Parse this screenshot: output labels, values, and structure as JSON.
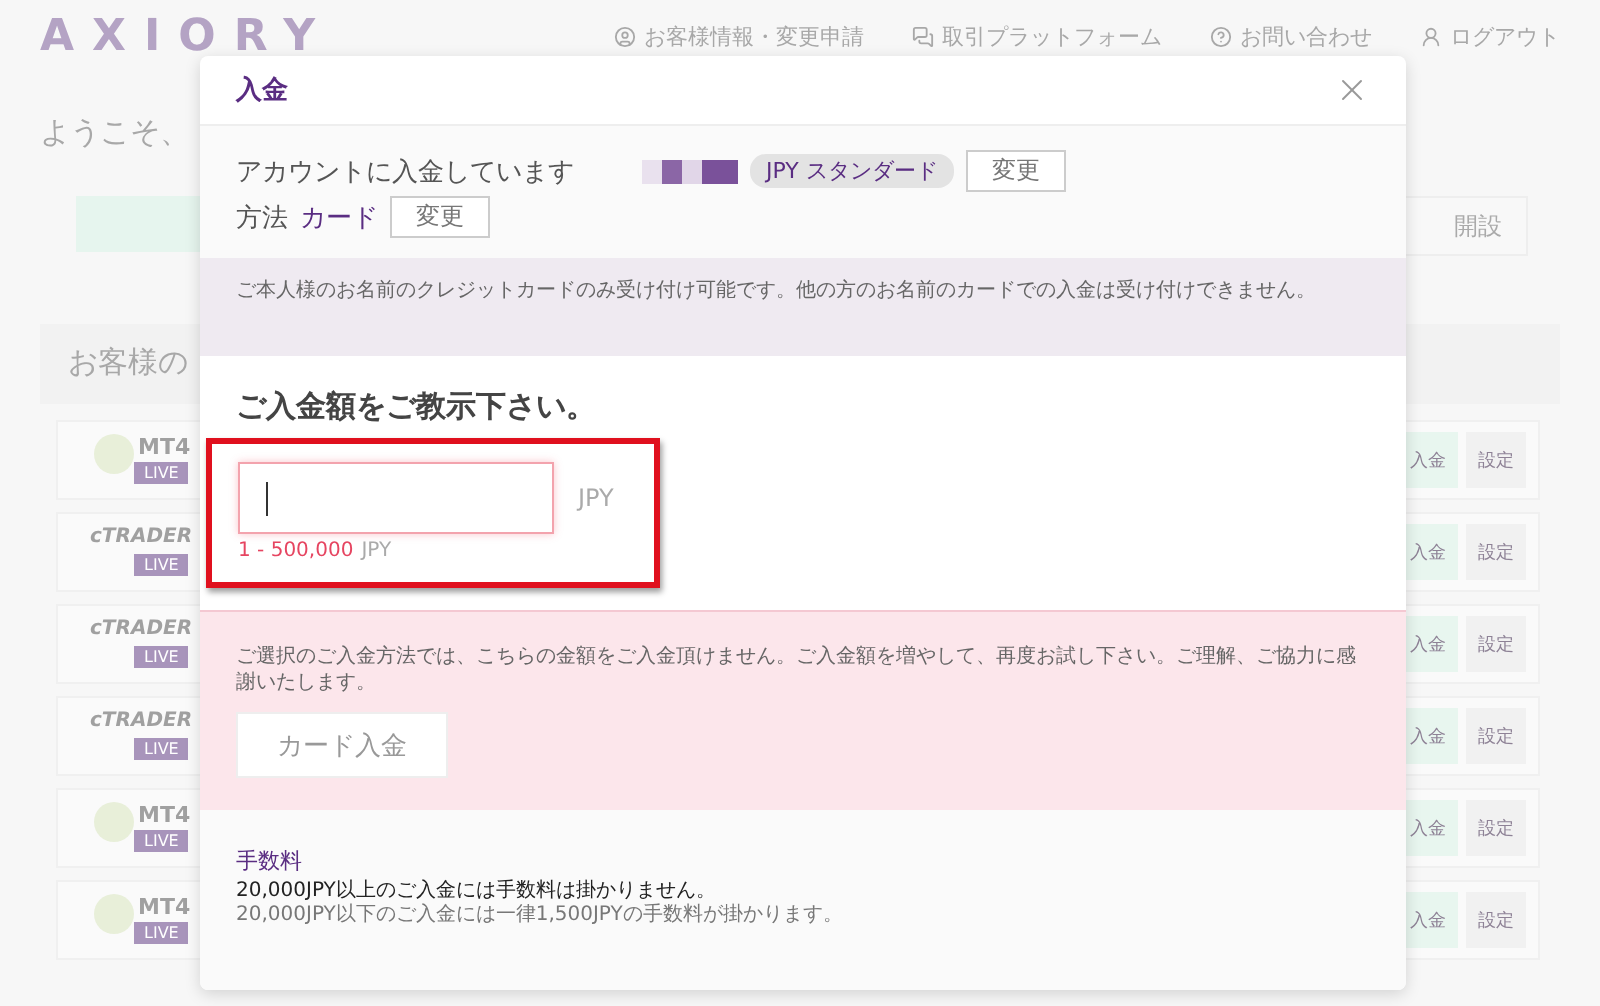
{
  "page": {
    "logo": "AXIORY",
    "nav": [
      {
        "label": "お客様情報・変更申請"
      },
      {
        "label": "取引プラットフォーム"
      },
      {
        "label": "お問い合わせ"
      },
      {
        "label": "ログアウト"
      }
    ],
    "welcome": "ようこそ、",
    "open_button": "開設",
    "section_title": "お客様の",
    "accounts": [
      {
        "kind": "mt4",
        "logo": "MT4",
        "badge": "LIVE",
        "buttons": [
          "入金",
          "設定"
        ]
      },
      {
        "kind": "ctrader",
        "logo": "cTRADER",
        "badge": "LIVE",
        "buttons": [
          "入金",
          "設定"
        ]
      },
      {
        "kind": "ctrader",
        "logo": "cTRADER",
        "badge": "LIVE",
        "buttons": [
          "入金",
          "設定"
        ]
      },
      {
        "kind": "ctrader",
        "logo": "cTRADER",
        "badge": "LIVE",
        "buttons": [
          "入金",
          "設定"
        ]
      },
      {
        "kind": "mt4",
        "logo": "MT4",
        "badge": "LIVE",
        "buttons": [
          "入金",
          "設定"
        ]
      },
      {
        "kind": "mt4",
        "logo": "MT4",
        "badge": "LIVE",
        "buttons": [
          "入金",
          "設定"
        ]
      }
    ]
  },
  "dialog": {
    "title": "入金",
    "account_label": "アカウントに入金しています",
    "account_tag": "JPY スタンダード",
    "change_button": "変更",
    "method_label": "方法",
    "method_value": "カード",
    "method_change_button": "変更",
    "notice": "ご本人様のお名前のクレジットカードのみ受け付け可能です。他の方のお名前のカードでの入金は受け付けできません。",
    "amount_heading": "ご入金額をご教示下さい。",
    "amount": {
      "error": true,
      "currency": "JPY",
      "range": "1 - 500,000",
      "range_currency": "JPY"
    },
    "error_message": "ご選択のご入金方法では、こちらの金額をご入金頂けません。ご入金額を増やして、再度お試し下さい。ご理解、ご協力に感謝いたします。",
    "submit": {
      "label": "カード入金",
      "disabled": true
    },
    "fee_title": "手数料",
    "fee_lines": [
      {
        "text": "20,000JPY以上のご入金には手数料は掛かりません。",
        "kind": "strong"
      },
      {
        "text": "20,000JPY以下のご入金には一律1,500JPYの手数料が掛かります。",
        "kind": "muted"
      }
    ]
  }
}
